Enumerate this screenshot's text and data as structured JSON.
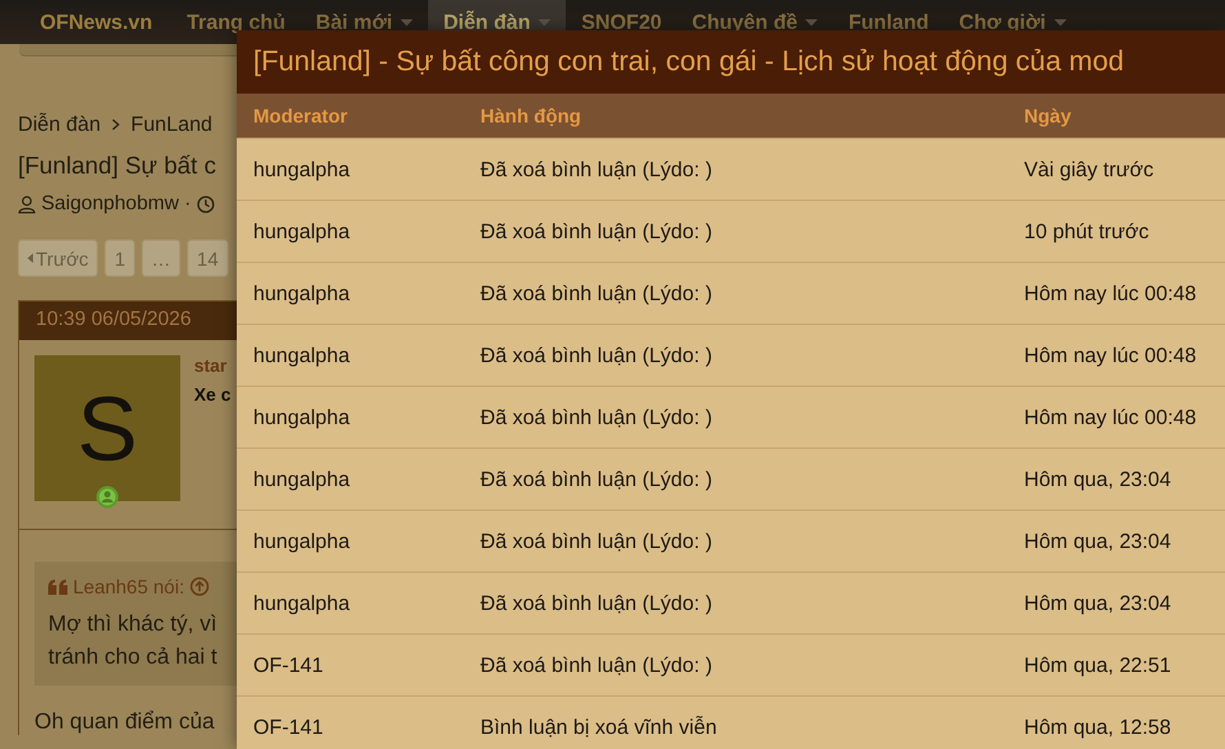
{
  "nav": {
    "brand": "OFNews.vn",
    "items": [
      {
        "label": "Trang chủ",
        "dropdown": false,
        "selected": false
      },
      {
        "label": "Bài mới",
        "dropdown": true,
        "selected": false
      },
      {
        "label": "Diễn đàn",
        "dropdown": true,
        "selected": true
      },
      {
        "label": "SNOF20",
        "dropdown": false,
        "selected": false
      },
      {
        "label": "Chuyên đề",
        "dropdown": true,
        "selected": false
      },
      {
        "label": "Funland",
        "dropdown": false,
        "selected": false
      },
      {
        "label": "Chợ giời",
        "dropdown": true,
        "selected": false
      }
    ]
  },
  "page": {
    "breadcrumb": [
      "Diễn đàn",
      "FunLand"
    ],
    "thread_title": "[Funland] Sự bất c",
    "author": "Saigonphobmw ·",
    "pagination": {
      "prev": "Trước",
      "pages": [
        "1",
        "…",
        "14"
      ]
    },
    "post": {
      "date": "10:39 06/05/2026",
      "avatar_letter": "S",
      "username": "star",
      "user_title": "Xe c",
      "quote": {
        "author": "Leanh65 nói:",
        "lines": [
          "Mợ thì khác tý, vì",
          "tránh cho cả hai t"
        ]
      },
      "body": "Oh quan điểm của"
    }
  },
  "modal": {
    "title": "[Funland] - Sự bất công con trai, con gái - Lịch sử hoạt động của mod",
    "columns": [
      "Moderator",
      "Hành động",
      "Ngày"
    ],
    "rows": [
      {
        "moderator": "hungalpha",
        "action": "Đã xoá bình luận (Lýdo: )",
        "date": "Vài giây trước"
      },
      {
        "moderator": "hungalpha",
        "action": "Đã xoá bình luận (Lýdo: )",
        "date": "10 phút trước"
      },
      {
        "moderator": "hungalpha",
        "action": "Đã xoá bình luận (Lýdo: )",
        "date": "Hôm nay lúc 00:48"
      },
      {
        "moderator": "hungalpha",
        "action": "Đã xoá bình luận (Lýdo: )",
        "date": "Hôm nay lúc 00:48"
      },
      {
        "moderator": "hungalpha",
        "action": "Đã xoá bình luận (Lýdo: )",
        "date": "Hôm nay lúc 00:48"
      },
      {
        "moderator": "hungalpha",
        "action": "Đã xoá bình luận (Lýdo: )",
        "date": "Hôm qua, 23:04"
      },
      {
        "moderator": "hungalpha",
        "action": "Đã xoá bình luận (Lýdo: )",
        "date": "Hôm qua, 23:04"
      },
      {
        "moderator": "hungalpha",
        "action": "Đã xoá bình luận (Lýdo: )",
        "date": "Hôm qua, 23:04"
      },
      {
        "moderator": "OF-141",
        "action": "Đã xoá bình luận (Lýdo: )",
        "date": "Hôm qua, 22:51"
      },
      {
        "moderator": "OF-141",
        "action": "Bình luận bị xoá vĩnh viễn",
        "date": "Hôm qua, 12:58"
      }
    ]
  }
}
